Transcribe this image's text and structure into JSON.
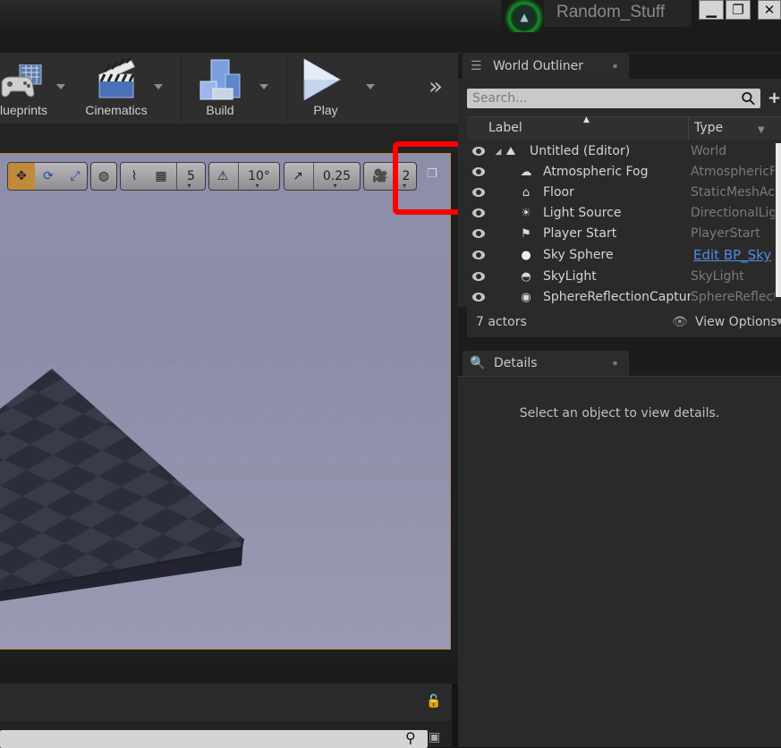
{
  "window": {
    "project_name": "Random_Stuff",
    "minimize": "▁",
    "restore": "❐",
    "close": "✕",
    "logo_icon": "graduation-cap-icon"
  },
  "toolbar": {
    "blueprints_label": "lueprints",
    "cinematics_label": "Cinematics",
    "build_label": "Build",
    "play_label": "Play",
    "expand_glyph": "»"
  },
  "viewport_toolbar": {
    "grid_snap_value": "5",
    "rotation_snap_value": "10°",
    "scale_snap_value": "0.25",
    "camera_speed_value": "2",
    "maximize_glyph": "❐"
  },
  "world_outliner": {
    "tab_label": "World Outliner",
    "search_placeholder": "Search...",
    "col_label": "Label",
    "col_type": "Type",
    "rows": [
      {
        "name": "Untitled (Editor)",
        "type": "World"
      },
      {
        "name": "Atmospheric Fog",
        "type": "AtmosphericF"
      },
      {
        "name": "Floor",
        "type": "StaticMeshAc"
      },
      {
        "name": "Light Source",
        "type": "DirectionalLig"
      },
      {
        "name": "Player Start",
        "type": "PlayerStart"
      },
      {
        "name": "Sky Sphere",
        "type": "Edit BP_Sky"
      },
      {
        "name": "SkyLight",
        "type": "SkyLight"
      },
      {
        "name": "SphereReflectionCaptur",
        "type": "SphereReflect"
      }
    ],
    "actor_count": "7 actors",
    "view_options": "View Options"
  },
  "details": {
    "tab_label": "Details",
    "empty_message": "Select an object to view details."
  },
  "colors": {
    "accent_link": "#4d8fe0",
    "highlight": "#ff0000",
    "viewport_border": "#b08a3c"
  }
}
